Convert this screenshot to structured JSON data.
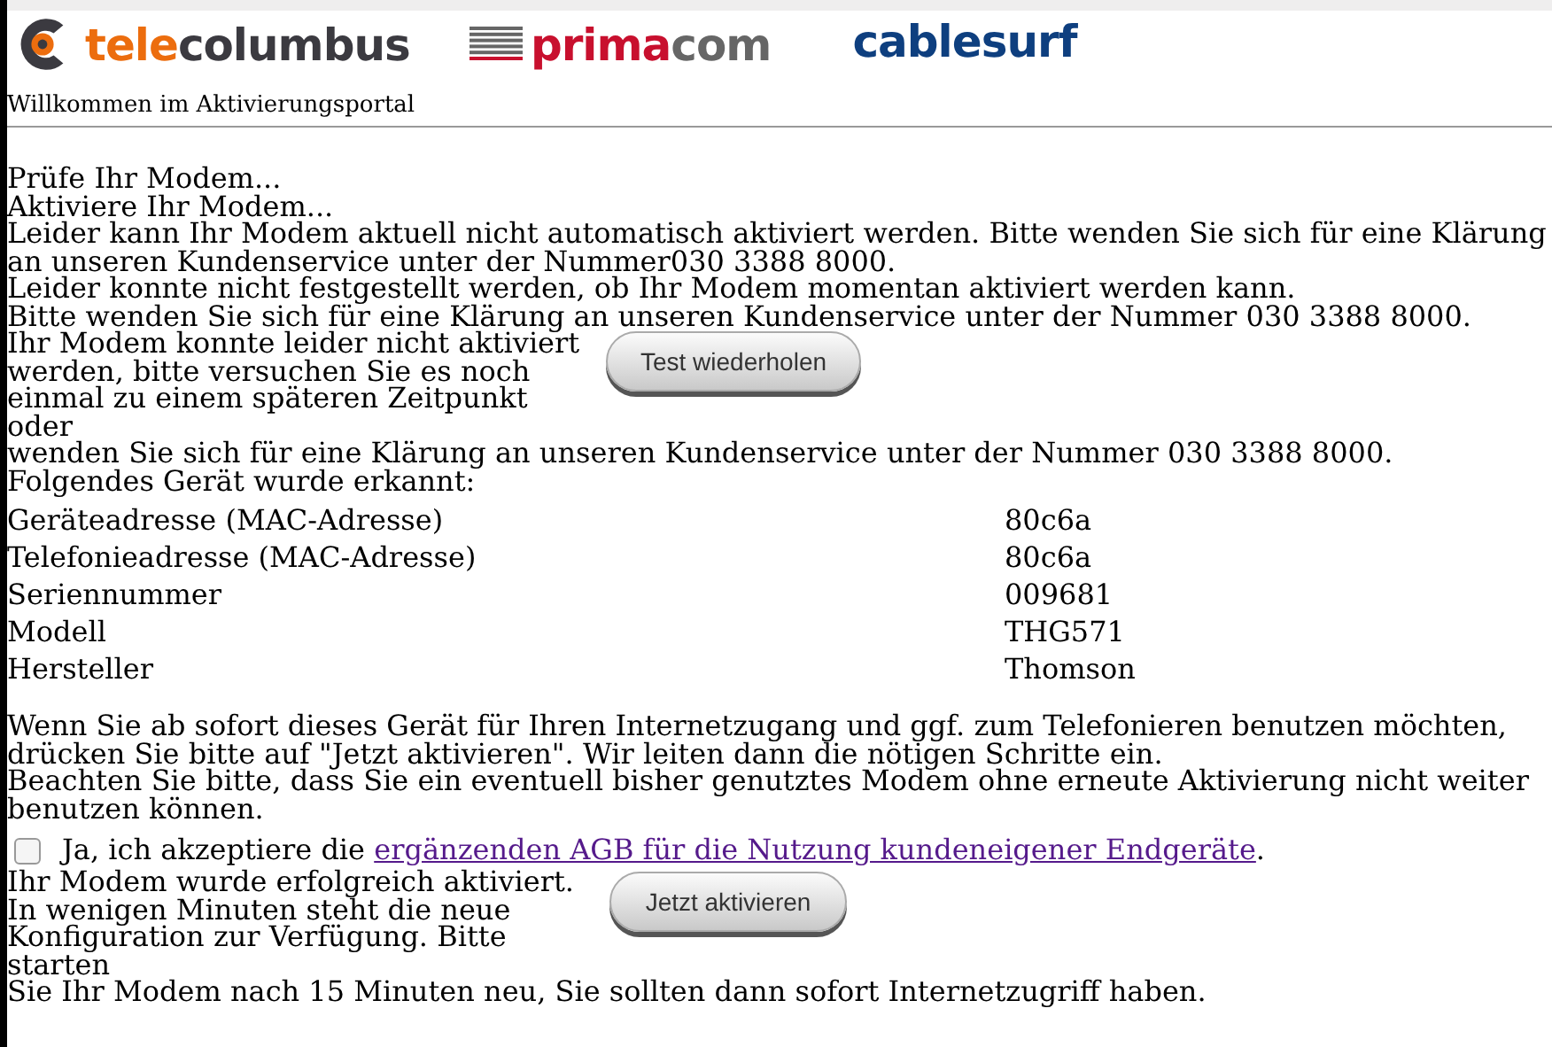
{
  "brands": [
    {
      "kind": "telecolumbus",
      "parts": [
        {
          "text": "tele",
          "color": "#ec6d0e"
        },
        {
          "text": "columbus",
          "color": "#3b3a40"
        }
      ]
    },
    {
      "kind": "primacom",
      "parts": [
        {
          "text": "prima",
          "color": "#c8102e"
        },
        {
          "text": "com",
          "color": "#666666"
        }
      ]
    },
    {
      "kind": "cablesurf",
      "parts": [
        {
          "text": "cablesurf",
          "color": "#0e3f7f"
        }
      ]
    }
  ],
  "welcome": "Willkommen im Aktivierungsportal",
  "status_lines": [
    "Prüfe Ihr Modem...",
    "Aktiviere Ihr Modem...",
    "Leider kann Ihr Modem aktuell nicht automatisch aktiviert werden. Bitte wenden Sie sich für eine Klärung an unseren Kundenservice unter der Nummer030 3388 8000.",
    "Leider konnte nicht festgestellt werden, ob Ihr Modem momentan aktiviert werden kann.",
    "Bitte wenden Sie sich für eine Klärung an unseren Kundenservice unter der Nummer 030 3388 8000."
  ],
  "retry": {
    "text": "Ihr Modem konnte leider nicht aktiviert werden, bitte versuchen Sie es noch einmal zu einem späteren Zeitpunkt oder",
    "button": "Test wiederholen",
    "text_continued": "wenden Sie sich für eine Klärung an unseren Kundenservice unter der Nummer 030 3388 8000."
  },
  "device_heading": "Folgendes Gerät wurde erkannt:",
  "device_rows": [
    {
      "label": "Geräteadresse (MAC-Adresse)",
      "value": "80c6a"
    },
    {
      "label": "Telefonieadresse (MAC-Adresse)",
      "value": "80c6a"
    },
    {
      "label": "Seriennummer",
      "value": "009681"
    },
    {
      "label": "Modell",
      "value": "THG571"
    },
    {
      "label": "Hersteller",
      "value": "Thomson"
    }
  ],
  "info": [
    "Wenn Sie ab sofort dieses Gerät für Ihren Internetzugang und ggf. zum Telefonieren benutzen möchten, drücken Sie bitte auf \"Jetzt aktivieren\". Wir leiten dann die nötigen Schritte ein.",
    "Beachten Sie bitte, dass Sie ein eventuell bisher genutztes Modem ohne erneute Aktivierung nicht weiter benutzen können."
  ],
  "agb": {
    "checked": false,
    "text": "Ja, ich akzeptiere die",
    "link": "ergänzenden AGB für die Nutzung kundeneigener Endgeräte",
    "end": "."
  },
  "success": {
    "text": "Ihr Modem wurde erfolgreich aktiviert. In wenigen Minuten steht die neue Konfiguration zur Verfügung. Bitte starten",
    "button": "Jetzt aktivieren",
    "text_continued": "Sie Ihr Modem nach 15 Minuten neu, Sie sollten dann sofort Internetzugriff haben."
  }
}
